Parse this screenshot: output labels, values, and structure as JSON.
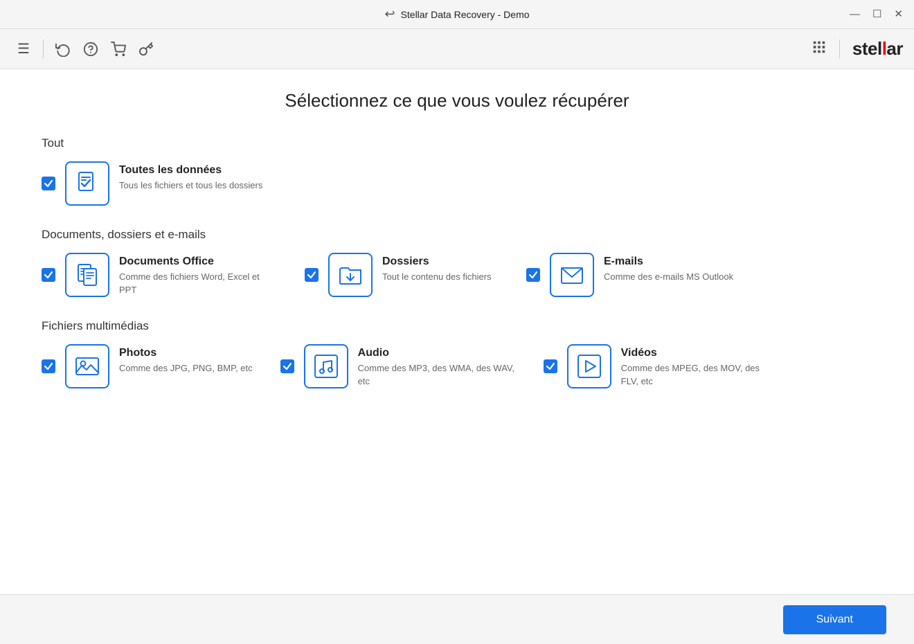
{
  "titleBar": {
    "title": "Stellar Data Recovery - Demo",
    "controls": {
      "minimize": "—",
      "maximize": "☐",
      "close": "✕"
    }
  },
  "toolbar": {
    "icons": [
      {
        "name": "menu-icon",
        "glyph": "☰"
      },
      {
        "name": "restore-icon",
        "glyph": "↺"
      },
      {
        "name": "help-icon",
        "glyph": "?"
      },
      {
        "name": "cart-icon",
        "glyph": "🛒"
      },
      {
        "name": "key-icon",
        "glyph": "🔑"
      }
    ],
    "brand": {
      "prefix": "stel",
      "highlight": "l",
      "suffix": "ar"
    }
  },
  "main": {
    "heading": "Sélectionnez ce que vous voulez récupérer",
    "sections": [
      {
        "id": "tout",
        "title": "Tout",
        "items": [
          {
            "id": "all-data",
            "name": "Toutes les données",
            "description": "Tous les fichiers et tous les dossiers",
            "checked": true
          }
        ]
      },
      {
        "id": "documents",
        "title": "Documents, dossiers et e-mails",
        "items": [
          {
            "id": "office-docs",
            "name": "Documents Office",
            "description": "Comme des fichiers Word, Excel et PPT",
            "checked": true
          },
          {
            "id": "folders",
            "name": "Dossiers",
            "description": "Tout le contenu des fichiers",
            "checked": true
          },
          {
            "id": "emails",
            "name": "E-mails",
            "description": "Comme des e-mails MS Outlook",
            "checked": true
          }
        ]
      },
      {
        "id": "multimedia",
        "title": "Fichiers multimédias",
        "items": [
          {
            "id": "photos",
            "name": "Photos",
            "description": "Comme des JPG, PNG, BMP, etc",
            "checked": true
          },
          {
            "id": "audio",
            "name": "Audio",
            "description": "Comme des MP3, des WMA, des WAV, etc",
            "checked": true
          },
          {
            "id": "videos",
            "name": "Vidéos",
            "description": "Comme des MPEG, des MOV, des FLV, etc",
            "checked": true
          }
        ]
      }
    ]
  },
  "footer": {
    "nextButton": "Suivant"
  },
  "colors": {
    "blue": "#1a73e8",
    "red": "#e00000"
  }
}
